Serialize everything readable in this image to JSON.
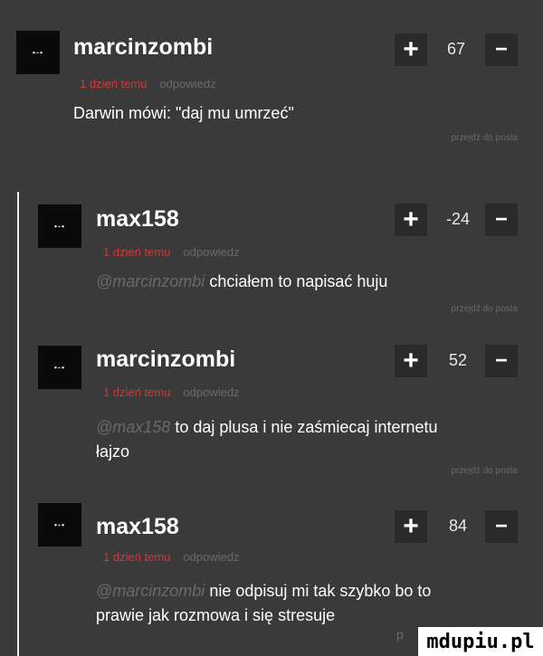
{
  "comments": [
    {
      "username": "marcinzombi",
      "score": "67",
      "time": "1 dzień temu",
      "reply": "odpowiedz",
      "mention": "",
      "text": "Darwin mówi: \"daj mu umrzeć\"",
      "goto": "przejdź do posta"
    },
    {
      "username": "max158",
      "score": "-24",
      "time": "1 dzień temu",
      "reply": "odpowiedz",
      "mention": "@marcinzombi",
      "text": "chciałem to napisać huju",
      "goto": "przejdź do posta"
    },
    {
      "username": "marcinzombi",
      "score": "52",
      "time": "1 dzień temu",
      "reply": "odpowiedz",
      "mention": "@max158",
      "text": "to daj plusa i nie zaśmiecaj internetu\nłajzo",
      "goto": "przejdź do posta"
    },
    {
      "username": "max158",
      "score": "84",
      "time": "1 dzień temu",
      "reply": "odpowiedz",
      "mention": "@marcinzombi",
      "text": "nie odpisuj mi tak szybko bo to\nprawie jak rozmowa i się stresuje",
      "goto": ""
    }
  ],
  "vote": {
    "plus": "+",
    "minus": "−"
  },
  "avatar_mark": "•-•",
  "stray_char": "p",
  "watermark": "mdupiu.pl",
  "colors": {
    "background": "#3a3a3a",
    "time": "#cc3a3a",
    "muted": "#6a6a6a",
    "vote_bg": "#2a2a2a"
  }
}
